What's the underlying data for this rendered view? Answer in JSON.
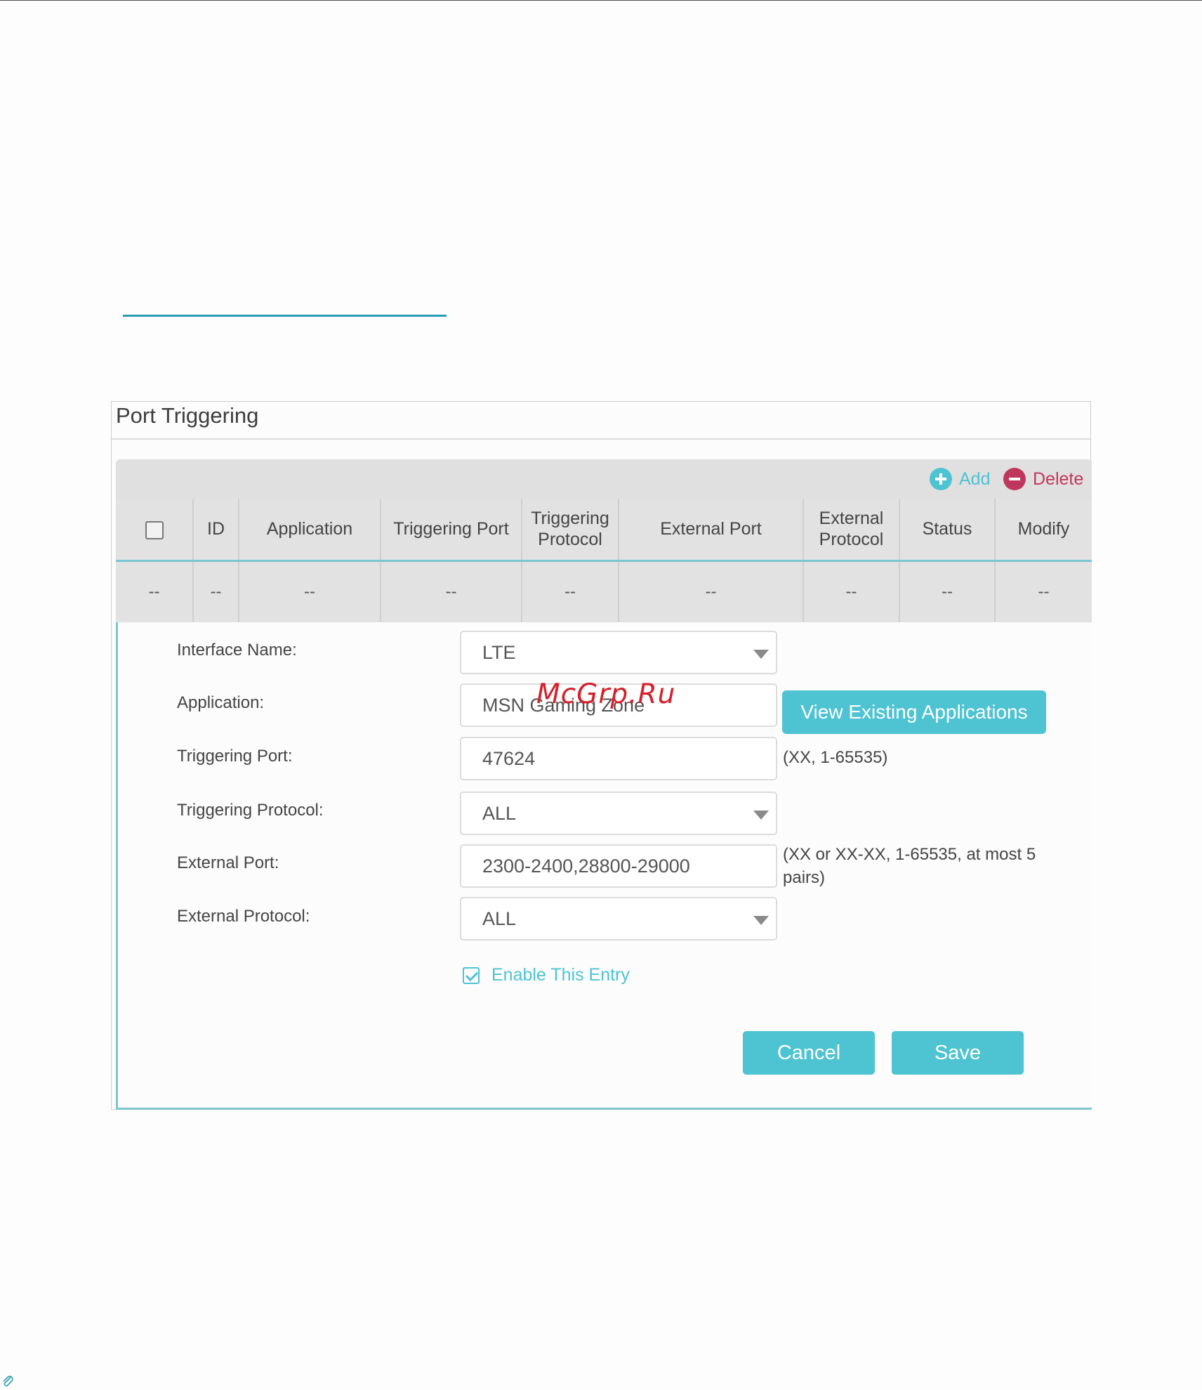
{
  "panel": {
    "title": "Port Triggering"
  },
  "toolbar": {
    "add_label": "Add",
    "delete_label": "Delete"
  },
  "table": {
    "headers": [
      "ID",
      "Application",
      "Triggering Port",
      "Triggering Protocol",
      "External Port",
      "External Protocol",
      "Status",
      "Modify"
    ],
    "rows": [
      [
        "--",
        "--",
        "--",
        "--",
        "--",
        "--",
        "--",
        "--",
        "--"
      ]
    ]
  },
  "form": {
    "interface_name": {
      "label": "Interface Name:",
      "value": "LTE"
    },
    "application": {
      "label": "Application:",
      "value": "MSN Gaming Zone",
      "view_button": "View Existing Applications"
    },
    "triggering_port": {
      "label": "Triggering Port:",
      "value": "47624",
      "hint": "(XX, 1-65535)"
    },
    "triggering_protocol": {
      "label": "Triggering Protocol:",
      "value": "ALL"
    },
    "external_port": {
      "label": "External Port:",
      "value": "2300-2400,28800-29000",
      "hint": "(XX or XX-XX, 1-65535, at most 5 pairs)"
    },
    "external_protocol": {
      "label": "External Protocol:",
      "value": "ALL"
    },
    "enable_entry": {
      "label": "Enable This Entry",
      "checked": true
    },
    "cancel_label": "Cancel",
    "save_label": "Save"
  },
  "watermark": {
    "text": "McGrp.Ru"
  },
  "colors": {
    "accent": "#4ec3d2",
    "delete": "#c0375d",
    "underline": "#2a9bb4",
    "watermark": "#d4202a"
  },
  "icons": [
    "add-icon",
    "delete-icon",
    "chevron-down-icon",
    "checkbox-icon",
    "check-icon",
    "paperclip-icon"
  ]
}
